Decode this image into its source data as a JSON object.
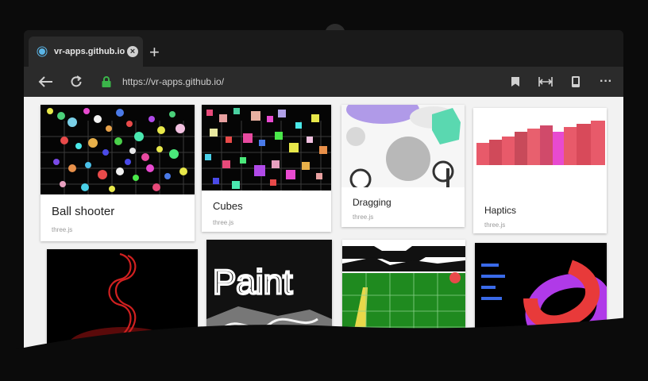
{
  "browser": {
    "add_button_label": "+",
    "tab": {
      "title": "vr-apps.github.io",
      "close_label": "×"
    },
    "new_tab_label": "+",
    "toolbar": {
      "url": "https://vr-apps.github.io/",
      "more_label": "···"
    }
  },
  "cards": [
    {
      "title": "Ball shooter",
      "subtitle": "three.js"
    },
    {
      "title": "Cubes",
      "subtitle": "three.js"
    },
    {
      "title": "Dragging",
      "subtitle": "three.js"
    },
    {
      "title": "Haptics",
      "subtitle": "three.js"
    }
  ],
  "paint_text": "Paint",
  "colors": {
    "secure": "#3bb54a",
    "page_bg": "#f2f2f2"
  }
}
